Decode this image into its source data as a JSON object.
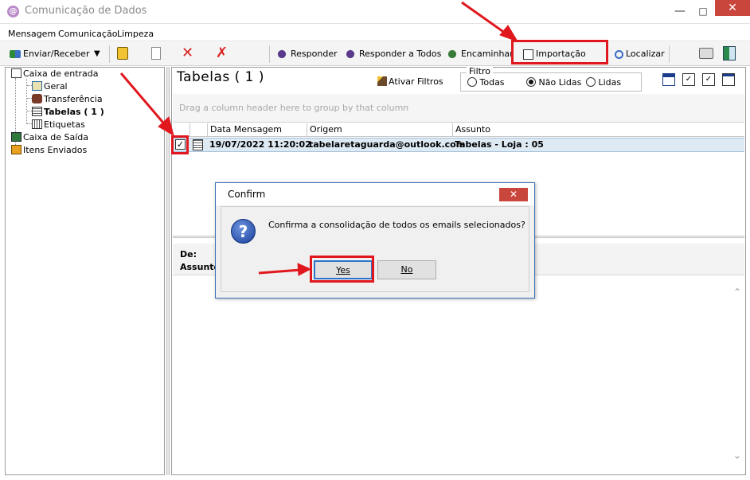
{
  "window": {
    "title": "Comunicação de Dados"
  },
  "menu": [
    "Mensagem",
    "Comunicação",
    "Limpeza"
  ],
  "toolbar": {
    "send_receive": "Enviar/Receber",
    "reply": "Responder",
    "reply_all": "Responder a Todos",
    "forward": "Encaminhar",
    "import": "Importação",
    "find": "Localizar"
  },
  "tree": {
    "inbox": "Caixa de entrada",
    "general": "Geral",
    "transfer": "Transferência",
    "tables": "Tabelas  ( 1 )",
    "labels": "Etiquetas",
    "outbox": "Caixa de Saída",
    "sent": "Itens Enviados"
  },
  "main": {
    "title": "Tabelas  ( 1 )",
    "activate_filters": "Ativar Filtros",
    "filter": {
      "legend": "Filtro",
      "options": [
        "Todas",
        "Não Lidas",
        "Lidas"
      ],
      "selected": "Não Lidas"
    },
    "group_hint": "Drag a column header here to group by that column",
    "columns": [
      "Data Mensagem",
      "Origem",
      "Assunto"
    ],
    "rows": [
      {
        "checked": true,
        "date": "19/07/2022 11:20:02",
        "origin": "tabelaretaguarda@outlook.com",
        "subject": "Tabelas - Loja : 05"
      }
    ],
    "preview": {
      "from_label": "De:",
      "subject_label": "Assunto"
    }
  },
  "dialog": {
    "title": "Confirm",
    "message": "Confirma a consolidação de todos os emails selecionados?",
    "yes": "Yes",
    "no": "No"
  },
  "colors": {
    "annotation": "#e0181e",
    "selected_row": "#dde9f3",
    "dialog_border": "#3b6fb6"
  }
}
